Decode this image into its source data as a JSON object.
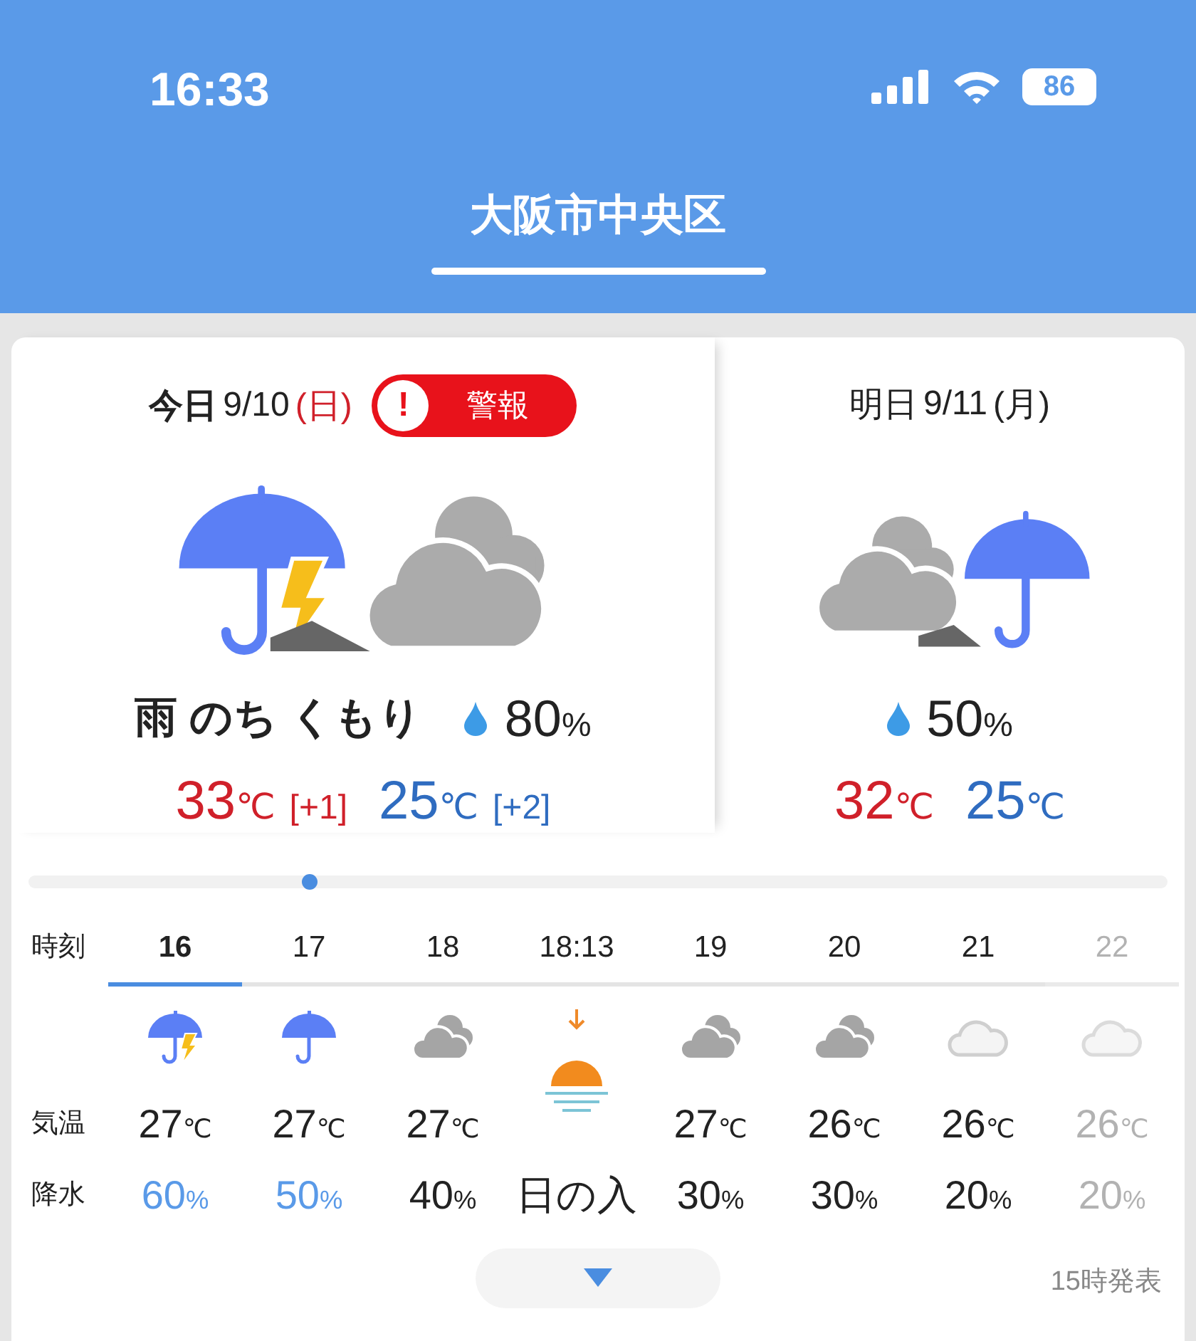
{
  "status_bar": {
    "time": "16:33",
    "battery": "86"
  },
  "header": {
    "title": "大阪市中央区",
    "selected": true
  },
  "days": [
    {
      "label": "今日",
      "date": "9/10",
      "weekday": "(日)",
      "holiday": true,
      "alert": {
        "icon": "!",
        "label": "警報"
      },
      "icon": {
        "kind": "rain_thunder_then_cloudy"
      },
      "weather": "雨 のち くもり",
      "rain_chance": "80",
      "rain_unit": "%",
      "high": "33",
      "high_unit": "℃",
      "high_diff": "[+1]",
      "low": "25",
      "low_unit": "℃",
      "low_diff": "[+2]"
    },
    {
      "label": "明日",
      "date": "9/11",
      "weekday": "(月)",
      "holiday": false,
      "icon": {
        "kind": "cloudy_then_rain"
      },
      "rain_chance": "50",
      "rain_unit": "%",
      "high": "32",
      "high_unit": "℃",
      "low": "25",
      "low_unit": "℃"
    }
  ],
  "hourly": {
    "row_labels": [
      "時刻",
      "気温",
      "降水"
    ],
    "hours": [
      {
        "time": "16",
        "selected": true,
        "dimmed": false,
        "kind": "rain_thunder",
        "temp": "27",
        "temp_unit": "℃",
        "precip": "60",
        "precip_unit": "%",
        "rainy": true
      },
      {
        "time": "17",
        "selected": false,
        "dimmed": false,
        "kind": "rain",
        "temp": "27",
        "temp_unit": "℃",
        "precip": "50",
        "precip_unit": "%",
        "rainy": true
      },
      {
        "time": "18",
        "selected": false,
        "dimmed": false,
        "kind": "cloudy",
        "temp": "27",
        "temp_unit": "℃",
        "precip": "40",
        "precip_unit": "%",
        "rainy": false
      },
      {
        "time": "18:13",
        "selected": false,
        "dimmed": false,
        "kind": "sunset",
        "precip": "日の入",
        "rainy": false
      },
      {
        "time": "19",
        "selected": false,
        "dimmed": false,
        "kind": "cloudy",
        "temp": "27",
        "temp_unit": "℃",
        "precip": "30",
        "precip_unit": "%",
        "rainy": false
      },
      {
        "time": "20",
        "selected": false,
        "dimmed": false,
        "kind": "cloudy",
        "temp": "26",
        "temp_unit": "℃",
        "precip": "30",
        "precip_unit": "%",
        "rainy": false
      },
      {
        "time": "21",
        "selected": false,
        "dimmed": false,
        "kind": "cloud_light",
        "temp": "26",
        "temp_unit": "℃",
        "precip": "20",
        "precip_unit": "%",
        "rainy": false
      },
      {
        "time": "22",
        "selected": false,
        "dimmed": true,
        "kind": "cloud_light",
        "temp": "26",
        "temp_unit": "℃",
        "precip": "20",
        "precip_unit": "%",
        "rainy": false
      }
    ]
  },
  "footer": {
    "published": "15時発表"
  }
}
